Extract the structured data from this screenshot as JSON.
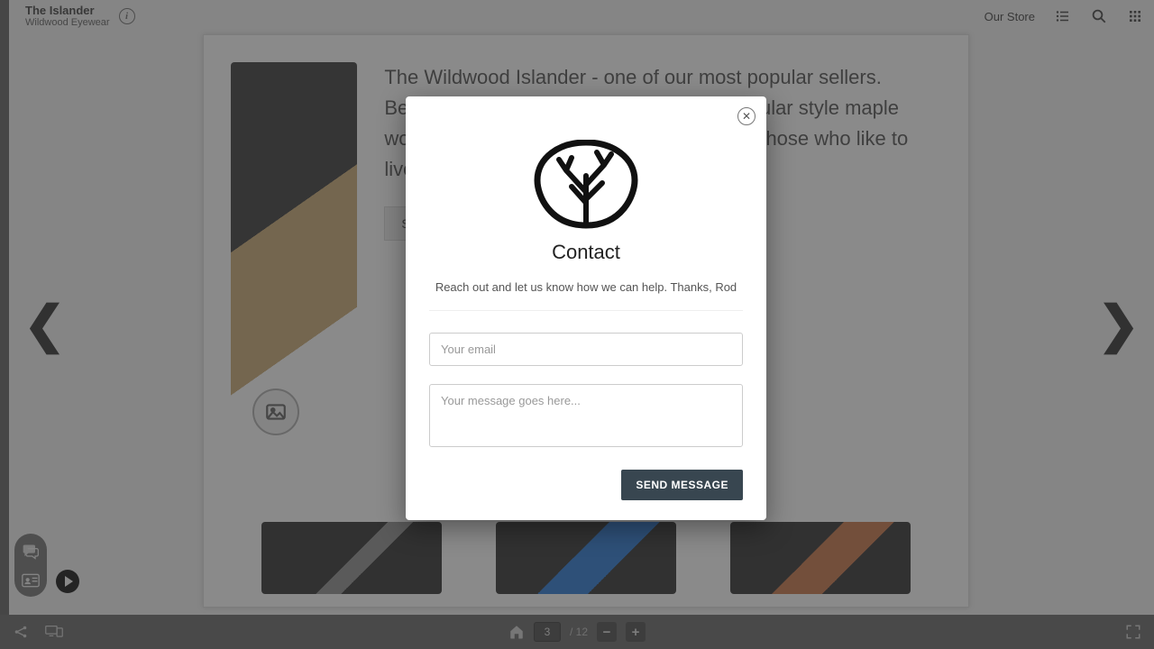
{
  "header": {
    "title": "The Islander",
    "subtitle": "Wildwood Eyewear",
    "store_link": "Our Store"
  },
  "product": {
    "description": "The Wildwood Islander - one of our most popular sellers. Beautiful, eco friendly, handcrafted rectangular style maple wood sunglasses with polarized lenses for those who like to live the dream, one island at a time.",
    "button": "SHOP IN STORE"
  },
  "pager": {
    "current": "3",
    "total": "/ 12",
    "minus": "−",
    "plus": "+"
  },
  "modal": {
    "title": "Contact",
    "message": "Reach out and let us know how we can help. Thanks, Rod",
    "email_placeholder": "Your email",
    "body_placeholder": "Your message goes here...",
    "send": "SEND MESSAGE"
  }
}
